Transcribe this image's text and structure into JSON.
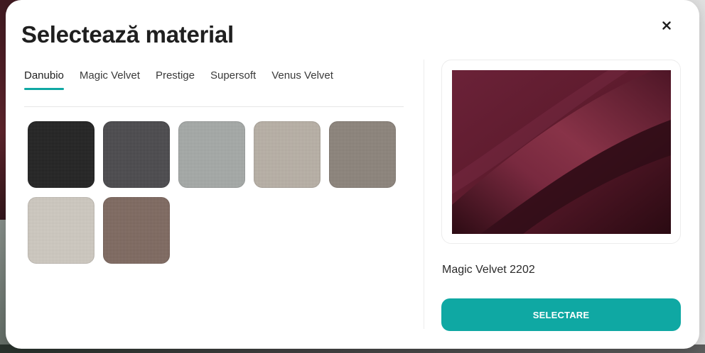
{
  "modal": {
    "title": "Selectează material",
    "close_icon": "close-icon"
  },
  "tabs": [
    {
      "label": "Danubio",
      "active": true
    },
    {
      "label": "Magic Velvet",
      "active": false
    },
    {
      "label": "Prestige",
      "active": false
    },
    {
      "label": "Supersoft",
      "active": false
    },
    {
      "label": "Venus Velvet",
      "active": false
    }
  ],
  "swatches": [
    {
      "color": "#1f1f1f",
      "edge": "#2e2e2e"
    },
    {
      "color": "#4a494c",
      "edge": "#5b5a5e"
    },
    {
      "color": "#a8acaa",
      "edge": "#b6b9b7"
    },
    {
      "color": "#bcb3a9",
      "edge": "#c9c1b8"
    },
    {
      "color": "#8e857c",
      "edge": "#9d958c"
    },
    {
      "color": "#d3cdc4",
      "edge": "#ddd8d0"
    },
    {
      "color": "#806960",
      "edge": "#8f7a71"
    }
  ],
  "preview": {
    "name": "Magic Velvet 2202",
    "fabric_color": "#5c1a2c",
    "fabric_highlight": "#7a2a40",
    "fabric_shadow": "#2a0a12"
  },
  "select_button": {
    "label": "SELECTARE",
    "color": "#0fa8a3"
  }
}
